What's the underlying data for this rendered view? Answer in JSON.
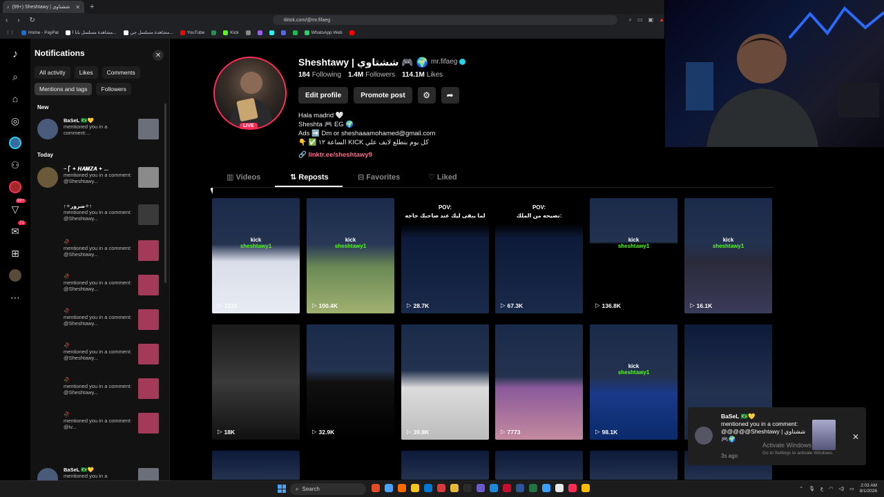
{
  "browser": {
    "tab_title": "(99+) Sheshtawy | ششتاوي",
    "new_tab": "+",
    "url": "tiktok.com/@mr.fifaeg",
    "bookmarks": [
      {
        "label": "Home - PayPal",
        "color": "#1a6bd6"
      },
      {
        "label": "مشاهدة مسلسل بابا ا...",
        "color": "#ffffff"
      },
      {
        "label": "مشاهدة مسلسل جي...",
        "color": "#ffffff"
      },
      {
        "label": "YouTube",
        "color": "#ff0000"
      },
      {
        "label": "",
        "color": "#2e8b57"
      },
      {
        "label": "Kick",
        "color": "#53fc18"
      },
      {
        "label": "",
        "color": "#888888"
      },
      {
        "label": "",
        "color": "#9b59ff"
      },
      {
        "label": "",
        "color": "#25f4ee"
      },
      {
        "label": "",
        "color": "#5865f2"
      },
      {
        "label": "",
        "color": "#1db954"
      },
      {
        "label": "WhatsApp Web",
        "color": "#25d366"
      },
      {
        "label": "",
        "color": "#ff0000"
      }
    ]
  },
  "rail": {
    "inbox_badge": "99+",
    "messages_badge": "71"
  },
  "notifications": {
    "title": "Notifications",
    "filters": [
      "All activity",
      "Likes",
      "Comments",
      "Mentions and tags",
      "Followers"
    ],
    "active_filter_index": 3,
    "section_new": "New",
    "section_today": "Today",
    "items": [
      {
        "user": "BaSeL 🇧🇷💛",
        "text": "mentioned you in a comment:...",
        "avatar": "#4a5a7a",
        "thumb": "#6a6f7a"
      },
      {
        "user": "~ ⎡ ✦ 𝑯𝑨𝑴𝒁𝑨 ✦ ...",
        "text": "mentioned you in a comment: @Sheshtawy...",
        "avatar": "#6a5a3a",
        "thumb": "#8a8a8a"
      },
      {
        "user": "↑✧ضرور✧↑",
        "text": "mentioned you in a comment: @Sheshtawy...",
        "avatar": "#121212",
        "thumb": "#3a3a3a"
      },
      {
        "user": "🥀",
        "text": "mentioned you in a comment: @Sheshtawy...",
        "avatar": "#121212",
        "thumb": "#a33a5a"
      },
      {
        "user": "🥀",
        "text": "mentioned you in a comment: @Sheshtawy...",
        "avatar": "#121212",
        "thumb": "#a33a5a"
      },
      {
        "user": "🥀",
        "text": "mentioned you in a comment: @Sheshtawy...",
        "avatar": "#121212",
        "thumb": "#a33a5a"
      },
      {
        "user": "🥀",
        "text": "mentioned you in a comment: @Sheshtawy...",
        "avatar": "#121212",
        "thumb": "#a33a5a"
      },
      {
        "user": "🥀",
        "text": "mentioned you in a comment: @Sheshtawy...",
        "avatar": "#121212",
        "thumb": "#a33a5a"
      },
      {
        "user": "🥀",
        "text": "mentioned you in a comment: @iv...",
        "avatar": "#121212",
        "thumb": "#a33a5a"
      },
      {
        "user": "BaSeL 🇧🇷💛",
        "text": "mentioned you in a",
        "avatar": "#4a5a7a",
        "thumb": "#6a6f7a"
      }
    ]
  },
  "profile": {
    "name": "Sheshtawy | ششتاوي 🎮 🌍",
    "username": "mr.fifaeg",
    "following_count": "184",
    "following_label": "Following",
    "followers_count": "1.4M",
    "followers_label": "Followers",
    "likes_count": "114.1M",
    "likes_label": "Likes",
    "live_label": "LIVE",
    "edit_label": "Edit profile",
    "promote_label": "Promote post",
    "bio_lines": [
      "Hala madrid 🤍",
      "Sheshta 🎮 EG 🌍",
      "Ads ➡️ Dm or sheshaaamohamed@gmail.com",
      "كل يوم بنطلع لايف علي KICK الساعة ١٢ ✅ 👇"
    ],
    "link": "linktr.ee/sheshtawy9"
  },
  "tabs": [
    "Videos",
    "Reposts",
    "Favorites",
    "Liked"
  ],
  "active_tab_index": 1,
  "videos": [
    {
      "views": "7231",
      "caption": "",
      "kick": true,
      "bg": "linear-gradient(180deg,#1a2a4a 0%,#23324f 40%,#d8dde8 55%,#e8ecf3 100%)"
    },
    {
      "views": "100.4K",
      "caption": "",
      "kick": true,
      "bg": "linear-gradient(180deg,#1a2a4a 0%,#283856 40%,#6a8a55 60%,#a0b070 100%)"
    },
    {
      "views": "28.7K",
      "caption": "POV:\nلما يبقى ليك عند صاحبك حاجه",
      "kick": false,
      "bg": "linear-gradient(180deg,#000 0%,#000 22%,#0d1a3a 35%,#1a2a4a 100%)"
    },
    {
      "views": "67.3K",
      "caption": "POV:\nنصيحه من الملك:",
      "kick": false,
      "bg": "linear-gradient(180deg,#000 0%,#000 22%,#0d1a3a 35%,#1a2a4a 100%)"
    },
    {
      "views": "136.8K",
      "caption": "",
      "kick": true,
      "bg": "linear-gradient(180deg,#1a2a4a 0%,#23324f 38%,#000 40%,#000 100%)"
    },
    {
      "views": "16.1K",
      "caption": "",
      "kick": true,
      "bg": "linear-gradient(180deg,#1a2a4a 0%,#23324f 40%,#2a2a3a 55%,#3a3a5a 100%)"
    },
    {
      "views": "18K",
      "caption": "",
      "kick": false,
      "bg": "linear-gradient(180deg,#1a1a1a 0%,#3a3a3a 50%,#111 100%)"
    },
    {
      "views": "32.9K",
      "caption": "",
      "kick": false,
      "bg": "linear-gradient(180deg,#1a2a4a 0%,#23324f 40%,#111 50%,#000 100%)"
    },
    {
      "views": "39.8K",
      "caption": "",
      "kick": false,
      "bg": "linear-gradient(180deg,#1a2a4a 0%,#23324f 40%,#dcdcdc 55%,#bcbcbc 100%)"
    },
    {
      "views": "7773",
      "caption": "",
      "kick": false,
      "bg": "linear-gradient(180deg,#1a2a4a 0%,#23324f 45%,#8a5a9a 55%,#c48aa0 100%)"
    },
    {
      "views": "98.1K",
      "caption": "",
      "kick": true,
      "bg": "linear-gradient(180deg,#1a2a4a 0%,#23324f 45%,#1a3a8a 60%,#0a2a6a 100%)"
    },
    {
      "views": "",
      "caption": "",
      "kick": false,
      "bg": "linear-gradient(180deg,#0d1a3a 0%,#23324f 60%,#1a2a4a 100%)"
    }
  ],
  "toast": {
    "user": "BaSeL 🇧🇷💛",
    "text": "mentioned you in a comment: @@@@@Sheshtawy | ششتاوي 🎮🌍",
    "time": "3s ago"
  },
  "watermark": {
    "title": "Activate Windows",
    "subtitle": "Go to Settings to activate Windows."
  },
  "taskbar": {
    "search": "Search",
    "time": "2:03 AM",
    "date": "8/1/2026",
    "apps": [
      "#e34c26",
      "#4aa3ff",
      "#ff6a00",
      "#f5c518",
      "#0078d4",
      "#d63a3a",
      "#e8b838",
      "#2b2b2b",
      "#6a5acd",
      "#1c8adb",
      "#c8102e",
      "#2b579a",
      "#217346",
      "#3aa0ff",
      "#e8e8e8",
      "#ff2c55",
      "#fbbc05"
    ]
  }
}
